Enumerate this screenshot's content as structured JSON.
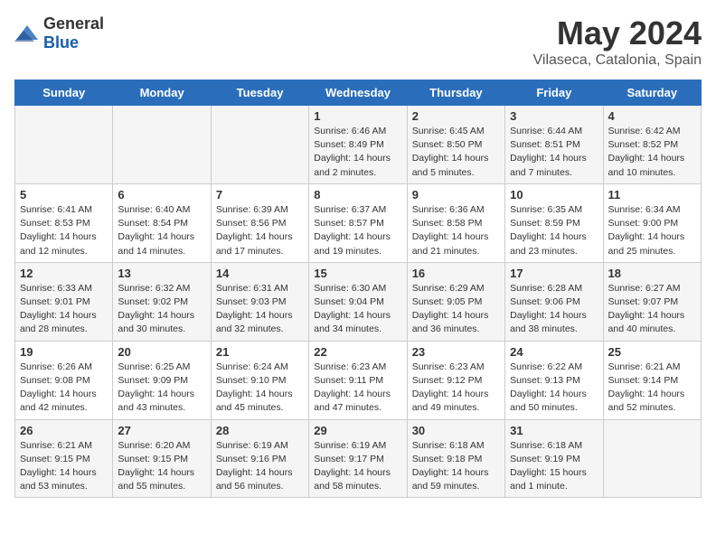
{
  "logo": {
    "general": "General",
    "blue": "Blue"
  },
  "title": "May 2024",
  "subtitle": "Vilaseca, Catalonia, Spain",
  "days_header": [
    "Sunday",
    "Monday",
    "Tuesday",
    "Wednesday",
    "Thursday",
    "Friday",
    "Saturday"
  ],
  "weeks": [
    [
      {
        "day": "",
        "sunrise": "",
        "sunset": "",
        "daylight": ""
      },
      {
        "day": "",
        "sunrise": "",
        "sunset": "",
        "daylight": ""
      },
      {
        "day": "",
        "sunrise": "",
        "sunset": "",
        "daylight": ""
      },
      {
        "day": "1",
        "sunrise": "Sunrise: 6:46 AM",
        "sunset": "Sunset: 8:49 PM",
        "daylight": "Daylight: 14 hours and 2 minutes."
      },
      {
        "day": "2",
        "sunrise": "Sunrise: 6:45 AM",
        "sunset": "Sunset: 8:50 PM",
        "daylight": "Daylight: 14 hours and 5 minutes."
      },
      {
        "day": "3",
        "sunrise": "Sunrise: 6:44 AM",
        "sunset": "Sunset: 8:51 PM",
        "daylight": "Daylight: 14 hours and 7 minutes."
      },
      {
        "day": "4",
        "sunrise": "Sunrise: 6:42 AM",
        "sunset": "Sunset: 8:52 PM",
        "daylight": "Daylight: 14 hours and 10 minutes."
      }
    ],
    [
      {
        "day": "5",
        "sunrise": "Sunrise: 6:41 AM",
        "sunset": "Sunset: 8:53 PM",
        "daylight": "Daylight: 14 hours and 12 minutes."
      },
      {
        "day": "6",
        "sunrise": "Sunrise: 6:40 AM",
        "sunset": "Sunset: 8:54 PM",
        "daylight": "Daylight: 14 hours and 14 minutes."
      },
      {
        "day": "7",
        "sunrise": "Sunrise: 6:39 AM",
        "sunset": "Sunset: 8:56 PM",
        "daylight": "Daylight: 14 hours and 17 minutes."
      },
      {
        "day": "8",
        "sunrise": "Sunrise: 6:37 AM",
        "sunset": "Sunset: 8:57 PM",
        "daylight": "Daylight: 14 hours and 19 minutes."
      },
      {
        "day": "9",
        "sunrise": "Sunrise: 6:36 AM",
        "sunset": "Sunset: 8:58 PM",
        "daylight": "Daylight: 14 hours and 21 minutes."
      },
      {
        "day": "10",
        "sunrise": "Sunrise: 6:35 AM",
        "sunset": "Sunset: 8:59 PM",
        "daylight": "Daylight: 14 hours and 23 minutes."
      },
      {
        "day": "11",
        "sunrise": "Sunrise: 6:34 AM",
        "sunset": "Sunset: 9:00 PM",
        "daylight": "Daylight: 14 hours and 25 minutes."
      }
    ],
    [
      {
        "day": "12",
        "sunrise": "Sunrise: 6:33 AM",
        "sunset": "Sunset: 9:01 PM",
        "daylight": "Daylight: 14 hours and 28 minutes."
      },
      {
        "day": "13",
        "sunrise": "Sunrise: 6:32 AM",
        "sunset": "Sunset: 9:02 PM",
        "daylight": "Daylight: 14 hours and 30 minutes."
      },
      {
        "day": "14",
        "sunrise": "Sunrise: 6:31 AM",
        "sunset": "Sunset: 9:03 PM",
        "daylight": "Daylight: 14 hours and 32 minutes."
      },
      {
        "day": "15",
        "sunrise": "Sunrise: 6:30 AM",
        "sunset": "Sunset: 9:04 PM",
        "daylight": "Daylight: 14 hours and 34 minutes."
      },
      {
        "day": "16",
        "sunrise": "Sunrise: 6:29 AM",
        "sunset": "Sunset: 9:05 PM",
        "daylight": "Daylight: 14 hours and 36 minutes."
      },
      {
        "day": "17",
        "sunrise": "Sunrise: 6:28 AM",
        "sunset": "Sunset: 9:06 PM",
        "daylight": "Daylight: 14 hours and 38 minutes."
      },
      {
        "day": "18",
        "sunrise": "Sunrise: 6:27 AM",
        "sunset": "Sunset: 9:07 PM",
        "daylight": "Daylight: 14 hours and 40 minutes."
      }
    ],
    [
      {
        "day": "19",
        "sunrise": "Sunrise: 6:26 AM",
        "sunset": "Sunset: 9:08 PM",
        "daylight": "Daylight: 14 hours and 42 minutes."
      },
      {
        "day": "20",
        "sunrise": "Sunrise: 6:25 AM",
        "sunset": "Sunset: 9:09 PM",
        "daylight": "Daylight: 14 hours and 43 minutes."
      },
      {
        "day": "21",
        "sunrise": "Sunrise: 6:24 AM",
        "sunset": "Sunset: 9:10 PM",
        "daylight": "Daylight: 14 hours and 45 minutes."
      },
      {
        "day": "22",
        "sunrise": "Sunrise: 6:23 AM",
        "sunset": "Sunset: 9:11 PM",
        "daylight": "Daylight: 14 hours and 47 minutes."
      },
      {
        "day": "23",
        "sunrise": "Sunrise: 6:23 AM",
        "sunset": "Sunset: 9:12 PM",
        "daylight": "Daylight: 14 hours and 49 minutes."
      },
      {
        "day": "24",
        "sunrise": "Sunrise: 6:22 AM",
        "sunset": "Sunset: 9:13 PM",
        "daylight": "Daylight: 14 hours and 50 minutes."
      },
      {
        "day": "25",
        "sunrise": "Sunrise: 6:21 AM",
        "sunset": "Sunset: 9:14 PM",
        "daylight": "Daylight: 14 hours and 52 minutes."
      }
    ],
    [
      {
        "day": "26",
        "sunrise": "Sunrise: 6:21 AM",
        "sunset": "Sunset: 9:15 PM",
        "daylight": "Daylight: 14 hours and 53 minutes."
      },
      {
        "day": "27",
        "sunrise": "Sunrise: 6:20 AM",
        "sunset": "Sunset: 9:15 PM",
        "daylight": "Daylight: 14 hours and 55 minutes."
      },
      {
        "day": "28",
        "sunrise": "Sunrise: 6:19 AM",
        "sunset": "Sunset: 9:16 PM",
        "daylight": "Daylight: 14 hours and 56 minutes."
      },
      {
        "day": "29",
        "sunrise": "Sunrise: 6:19 AM",
        "sunset": "Sunset: 9:17 PM",
        "daylight": "Daylight: 14 hours and 58 minutes."
      },
      {
        "day": "30",
        "sunrise": "Sunrise: 6:18 AM",
        "sunset": "Sunset: 9:18 PM",
        "daylight": "Daylight: 14 hours and 59 minutes."
      },
      {
        "day": "31",
        "sunrise": "Sunrise: 6:18 AM",
        "sunset": "Sunset: 9:19 PM",
        "daylight": "Daylight: 15 hours and 1 minute."
      },
      {
        "day": "",
        "sunrise": "",
        "sunset": "",
        "daylight": ""
      }
    ]
  ]
}
